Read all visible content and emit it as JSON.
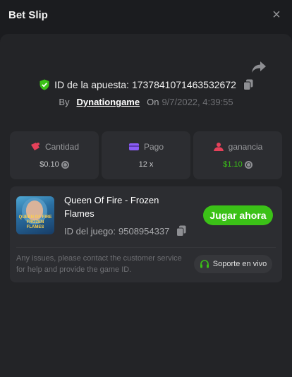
{
  "header": {
    "title": "Bet Slip",
    "close_icon": "×"
  },
  "bet": {
    "id_label": "ID de la apuesta:",
    "id_value": "1737841071463532672",
    "by_label": "By",
    "user": "Dynationgame",
    "on_label": "On",
    "date": "9/7/2022, 4:39:55"
  },
  "stats": [
    {
      "label": "Cantidad",
      "value": "$0.10",
      "icon": "amount-icon",
      "color": "#c7c8ca"
    },
    {
      "label": "Pago",
      "value": "12 x",
      "icon": "wallet-icon",
      "color": "#c7c8ca"
    },
    {
      "label": "ganancia",
      "value": "$1.10",
      "icon": "profit-icon",
      "color": "#3bc117"
    }
  ],
  "game": {
    "name": "Queen Of Fire - Frozen Flames",
    "thumb_caption": "QUEEN OF FIRE FROZEN FLAMES",
    "id_label": "ID del juego:",
    "id_value": "9508954337",
    "play_label": "Jugar ahora",
    "issues_text": "Any issues, please contact the customer service for help and provide the game ID.",
    "support_label": "Soporte en vivo"
  },
  "colors": {
    "accent_green": "#3bc117",
    "panel": "#232427",
    "card": "#2c2d31"
  }
}
